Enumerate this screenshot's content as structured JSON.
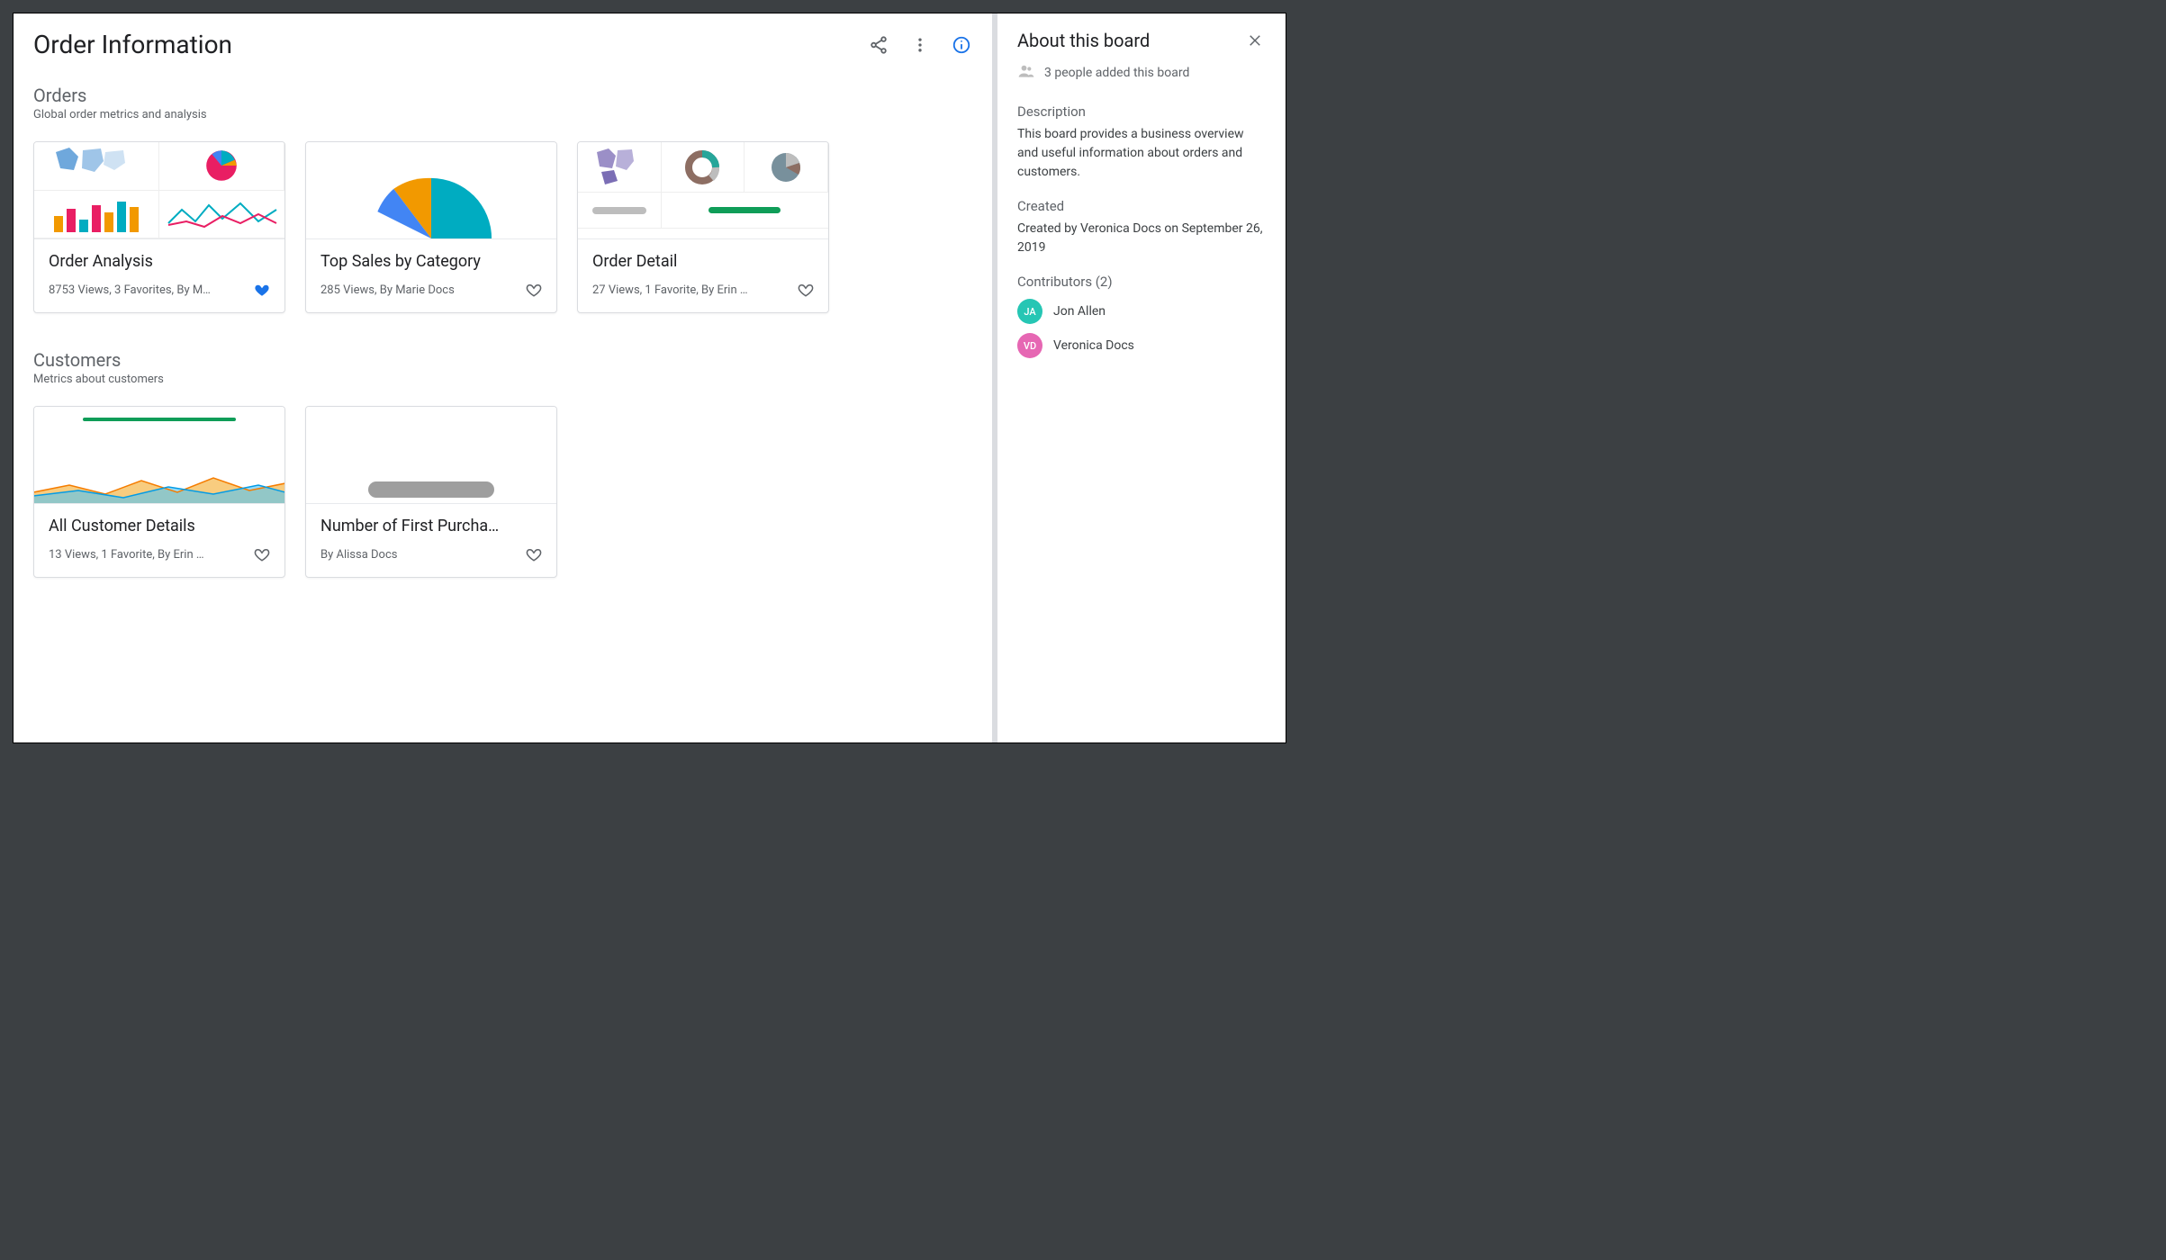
{
  "page_title": "Order Information",
  "sections": [
    {
      "title": "Orders",
      "subtitle": "Global order metrics and analysis",
      "cards": [
        {
          "title": "Order Analysis",
          "meta": "8753 Views, 3 Favorites, By M…",
          "favorited": true
        },
        {
          "title": "Top Sales by Category",
          "meta": "285 Views, By Marie Docs",
          "favorited": false
        },
        {
          "title": "Order Detail",
          "meta": "27 Views, 1 Favorite, By Erin …",
          "favorited": false
        }
      ]
    },
    {
      "title": "Customers",
      "subtitle": "Metrics about customers",
      "cards": [
        {
          "title": "All Customer Details",
          "meta": "13 Views, 1 Favorite, By Erin …",
          "favorited": false
        },
        {
          "title": "Number of First Purcha…",
          "meta": "By Alissa Docs",
          "favorited": false
        }
      ]
    }
  ],
  "sidebar": {
    "title": "About this board",
    "people_added": "3 people added this board",
    "description_label": "Description",
    "description": "This board provides a business overview and useful information about orders and customers.",
    "created_label": "Created",
    "created": "Created by Veronica Docs on September 26, 2019",
    "contributors_label": "Contributors (2)",
    "contributors": [
      {
        "initials": "JA",
        "name": "Jon Allen",
        "color": "teal"
      },
      {
        "initials": "VD",
        "name": "Veronica Docs",
        "color": "pink"
      }
    ]
  }
}
